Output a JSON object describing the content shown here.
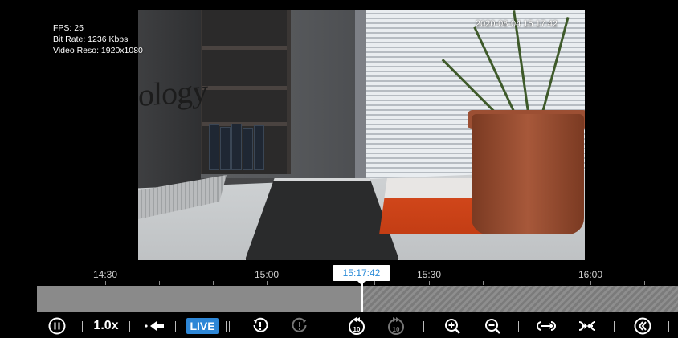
{
  "overlay": {
    "fps": "FPS: 25",
    "bitrate": "Bit Rate: 1236 Kbps",
    "resolution": "Video Reso: 1920x1080",
    "timestamp": "2020-08-04 15:17:42"
  },
  "video": {
    "camera_label_text": "ology"
  },
  "timeline": {
    "labels": [
      "14:30",
      "15:00",
      "15:30",
      "16:00"
    ],
    "current_time": "15:17:42",
    "recorded_color": "#8a8a8a",
    "cursor_color": "#2a8bd8"
  },
  "toolbar": {
    "speed": "1.0x",
    "live_label": "LIVE",
    "skip_back_seconds": "10",
    "skip_forward_seconds": "10",
    "accent": "#2d86d6",
    "icons": [
      "pause-icon",
      "back-to-prev-icon",
      "alert-prev-icon",
      "alert-next-icon",
      "rewind-10-icon",
      "forward-10-icon",
      "zoom-in-icon",
      "zoom-out-icon",
      "expand-timeline-icon",
      "collapse-timeline-icon",
      "collapse-panel-icon"
    ]
  }
}
